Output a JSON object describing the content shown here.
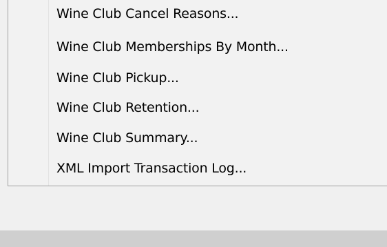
{
  "menu": {
    "items": [
      {
        "label": "Wine Club Cancel Reasons..."
      },
      {
        "label": "Wine Club Memberships By Month..."
      },
      {
        "label": "Wine Club Pickup..."
      },
      {
        "label": "Wine Club Retention..."
      },
      {
        "label": "Wine Club Summary..."
      },
      {
        "label": "XML Import Transaction Log..."
      }
    ]
  },
  "colors": {
    "menu_background": "#f2f2f2",
    "window_background": "#f0f0f0",
    "border": "#a0a0a0",
    "bottom_strip": "#cfcfcf",
    "text": "#000000"
  }
}
